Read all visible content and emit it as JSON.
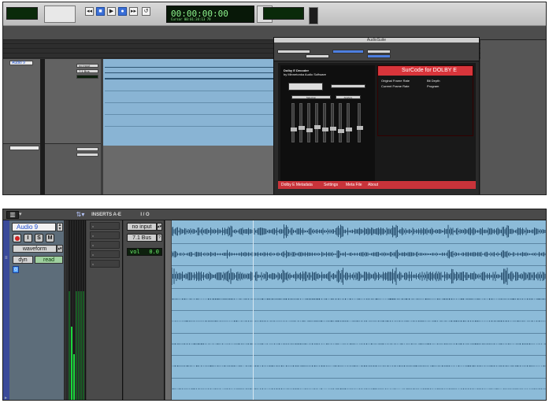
{
  "top": {
    "counter": "00:00:00:00",
    "counter_small": "Cursor 00:01:34:13 79"
  },
  "plugin": {
    "title": "AudioSuite",
    "product_line1": "Dolby E Decoder",
    "product_line2": "by Minnetonka Audio Software",
    "brand": "SurCode for DOLBY E",
    "button_selection": "Selection",
    "button_analyze": "Analyze",
    "labels": [
      "Original Frame Rate",
      "Current Frame Rate",
      "Bit Depth",
      "Program"
    ],
    "tabs": [
      "Dolby E Metadata",
      "Settings",
      "Meta File",
      "About"
    ]
  },
  "header": {
    "inserts_label": "INSERTS A-E",
    "io_label": "I / O"
  },
  "track": {
    "name": "Audio 9",
    "view": "waveform",
    "automation_mode": "dyn",
    "automation_state": "read",
    "buttons": {
      "input": "I",
      "solo": "S",
      "mute": "M"
    },
    "input": "no input",
    "output": "7.1 Bus",
    "vol_label": "vol",
    "vol_value": "0.0"
  },
  "colors": {
    "clip": "#8cbbd8",
    "waveform": "#284f6e",
    "meter": "#19d83b",
    "record": "#d12222",
    "track_name": "#1f4fd0"
  }
}
